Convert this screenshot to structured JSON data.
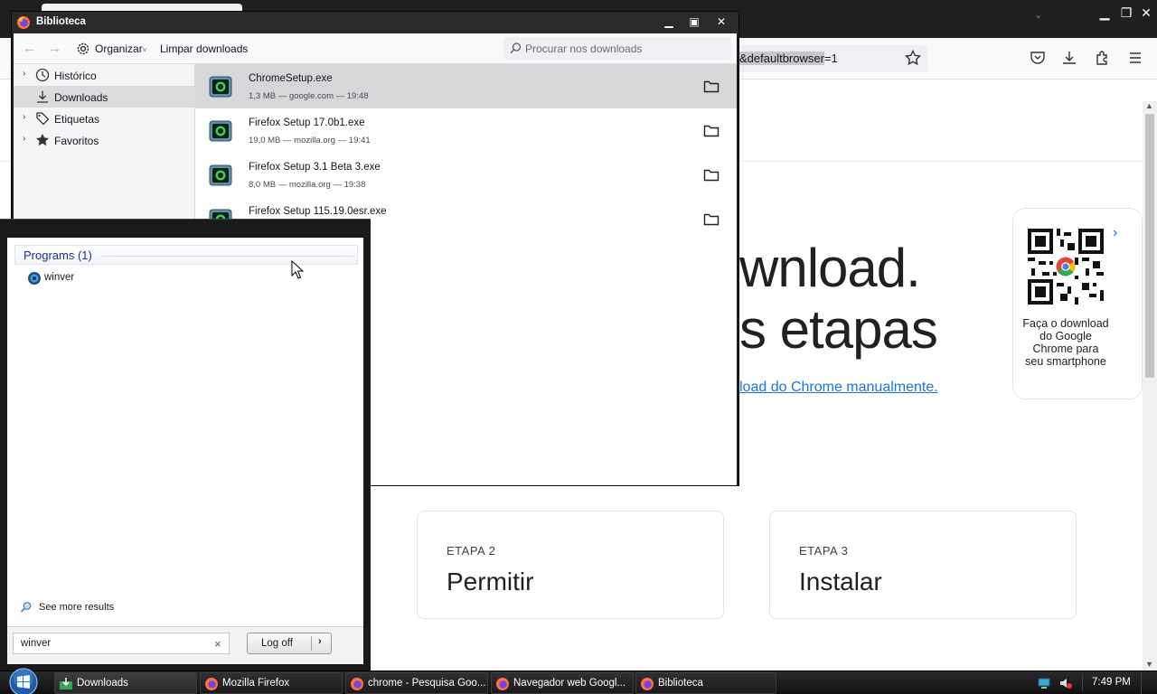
{
  "browser": {
    "url_fragment_selected": "&defaultbrowser",
    "url_fragment_rest": "=1",
    "page": {
      "headline_line1": "wnload.",
      "headline_line2": "s etapas",
      "manual_link": "load do Chrome manualmente.",
      "qr_card_text": "Faça o download do Google Chrome para seu smartphone",
      "steps": [
        {
          "label": "ETAPA 2",
          "title": "Permitir"
        },
        {
          "label": "ETAPA 3",
          "title": "Instalar"
        }
      ]
    }
  },
  "library": {
    "title": "Biblioteca",
    "toolbar": {
      "organize_label": "Organizar",
      "organize_caret": "˅",
      "clear_label": "Limpar downloads",
      "search_placeholder": "Procurar nos downloads"
    },
    "sidebar": {
      "items": [
        {
          "label": "Histórico",
          "icon": "clock-icon"
        },
        {
          "label": "Downloads",
          "icon": "download-icon"
        },
        {
          "label": "Etiquetas",
          "icon": "tag-icon"
        },
        {
          "label": "Favoritos",
          "icon": "star-icon"
        }
      ]
    },
    "downloads": [
      {
        "name": "ChromeSetup.exe",
        "meta": "1,3 MB — google.com — 19:48"
      },
      {
        "name": "Firefox Setup 17.0b1.exe",
        "meta": "19,0 MB — mozilla.org — 19:41"
      },
      {
        "name": "Firefox Setup 3.1 Beta 3.exe",
        "meta": "8,0 MB — mozilla.org — 19:38"
      },
      {
        "name": "Firefox Setup 115.19.0esr.exe",
        "meta": ""
      }
    ]
  },
  "startmenu": {
    "header": "Programs (1)",
    "results": [
      {
        "label": "winver"
      }
    ],
    "see_more": "See more results",
    "search_value": "winver",
    "clear_glyph": "×",
    "logoff_label": "Log off",
    "logoff_arrow": "›"
  },
  "taskbar": {
    "buttons": [
      {
        "label": "Downloads"
      },
      {
        "label": "Mozilla Firefox"
      },
      {
        "label": "chrome - Pesquisa Goo..."
      },
      {
        "label": "Navegador web Googl..."
      },
      {
        "label": "Biblioteca"
      }
    ],
    "clock": "7:49 PM"
  },
  "colors": {
    "link_blue": "#1a73e8",
    "start_header_blue": "#1e3287",
    "selected_row": "#d7d7d9"
  }
}
